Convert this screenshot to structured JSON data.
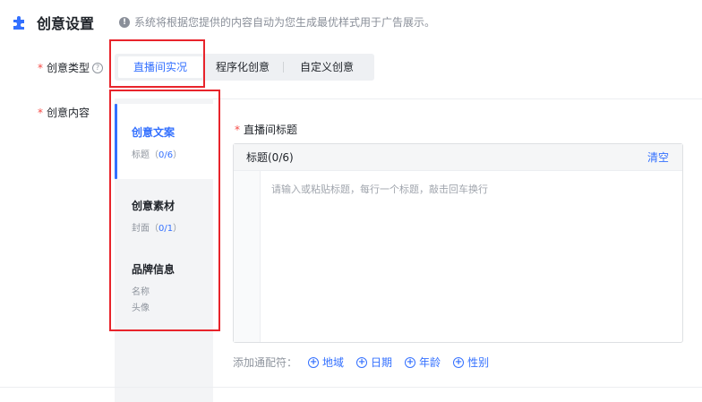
{
  "header": {
    "title": "创意设置",
    "info": "系统将根据您提供的内容自动为您生成最优样式用于广告展示。"
  },
  "form": {
    "creative_type_label": "创意类型",
    "creative_content_label": "创意内容"
  },
  "type_tabs": [
    "直播间实况",
    "程序化创意",
    "自定义创意"
  ],
  "side": [
    {
      "title": "创意文案",
      "sub_prefix": "标题（",
      "count": "0/6",
      "sub_suffix": "）"
    },
    {
      "title": "创意素材",
      "sub_prefix": "封面（",
      "count": "0/1",
      "sub_suffix": "）"
    },
    {
      "title": "品牌信息",
      "line1": "名称",
      "line2": "头像"
    }
  ],
  "editor": {
    "field_label": "直播间标题",
    "header_label": "标题(0/6)",
    "clear": "清空",
    "placeholder": "请输入或粘贴标题，每行一个标题，敲击回车换行"
  },
  "wildcards": {
    "label": "添加通配符：",
    "items": [
      "地域",
      "日期",
      "年龄",
      "性别"
    ]
  },
  "colors": {
    "accent": "#3370ff",
    "required": "#f54a45",
    "highlight_box": "#e8242b"
  }
}
